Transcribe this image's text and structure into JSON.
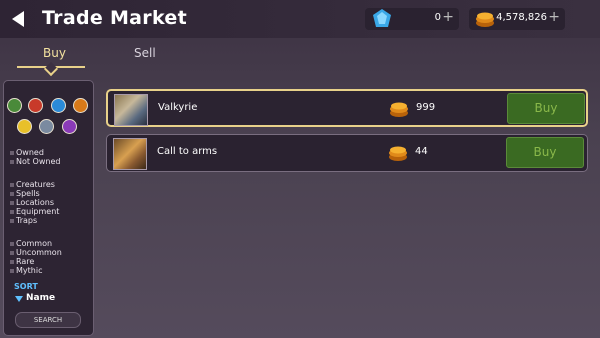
{
  "header": {
    "title": "Trade Market",
    "gems": "0",
    "coins": "4,578,826",
    "plus": "+"
  },
  "tabs": [
    {
      "label": "Buy",
      "active": true
    },
    {
      "label": "Sell",
      "active": false
    }
  ],
  "filters": {
    "elements": [
      {
        "name": "nature",
        "color": "#4a8a3a"
      },
      {
        "name": "fire",
        "color": "#c83a2a"
      },
      {
        "name": "water",
        "color": "#2a8ad8"
      },
      {
        "name": "earth",
        "color": "#d87a1a"
      },
      {
        "name": "light",
        "color": "#e8c02a"
      },
      {
        "name": "air",
        "color": "#7a8aa0"
      },
      {
        "name": "dark",
        "color": "#8a3ab8"
      }
    ],
    "ownership": [
      "Owned",
      "Not Owned"
    ],
    "types": [
      "Creatures",
      "Spells",
      "Locations",
      "Equipment",
      "Traps"
    ],
    "rarities": [
      "Common",
      "Uncommon",
      "Rare",
      "Mythic"
    ],
    "sort_label": "SORT",
    "sort_value": "Name",
    "search_label": "SEARCH"
  },
  "listings": [
    {
      "name": "Valkyrie",
      "price": "999",
      "button": "Buy",
      "selected": true
    },
    {
      "name": "Call to arms",
      "price": "44",
      "button": "Buy",
      "selected": false
    }
  ],
  "colors": {
    "accent": "#e8d18a",
    "buy_button": "#3a6a22",
    "sort_accent": "#5fc0ff"
  }
}
